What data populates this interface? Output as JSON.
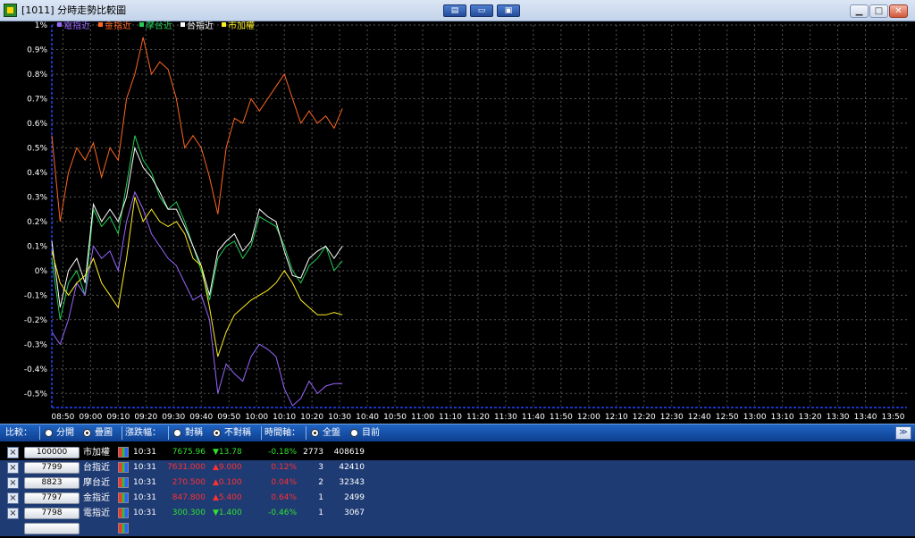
{
  "window": {
    "title": "[1011] 分時走勢比較圖",
    "toolbar_buttons": [
      "▤",
      "▭",
      "▣"
    ],
    "controls": {
      "minimize": "▁",
      "maximize": "□",
      "close": "✕"
    }
  },
  "legend": [
    {
      "name": "電指近",
      "color": "#9966ff"
    },
    {
      "name": "金指近",
      "color": "#ff6622"
    },
    {
      "name": "摩台近",
      "color": "#22cc55"
    },
    {
      "name": "台指近",
      "color": "#ffffff"
    },
    {
      "name": "市加權",
      "color": "#ffee22"
    }
  ],
  "chart_data": {
    "type": "line",
    "y_ticks": [
      "1%",
      "0.9%",
      "0.8%",
      "0.7%",
      "0.6%",
      "0.5%",
      "0.4%",
      "0.3%",
      "0.2%",
      "0.1%",
      "0%",
      "-0.1%",
      "-0.2%",
      "-0.3%",
      "-0.4%",
      "-0.5%"
    ],
    "x_ticks": [
      "08:50",
      "09:00",
      "09:10",
      "09:20",
      "09:30",
      "09:40",
      "09:50",
      "10:00",
      "10:10",
      "10:20",
      "10:30",
      "10:40",
      "10:50",
      "11:00",
      "11:10",
      "11:20",
      "11:30",
      "11:40",
      "11:50",
      "12:00",
      "12:10",
      "12:20",
      "12:30",
      "12:40",
      "12:50",
      "13:00",
      "13:10",
      "13:20",
      "13:30",
      "13:40",
      "13:50"
    ],
    "ylim": [
      -0.55,
      1.0
    ],
    "grid": true,
    "series": [
      {
        "name": "金指近",
        "color": "#ff6622",
        "x": [
          "08:46",
          "08:49",
          "08:52",
          "08:55",
          "08:58",
          "09:01",
          "09:04",
          "09:07",
          "09:10",
          "09:13",
          "09:16",
          "09:19",
          "09:22",
          "09:25",
          "09:28",
          "09:31",
          "09:34",
          "09:37",
          "09:40",
          "09:43",
          "09:46",
          "09:49",
          "09:52",
          "09:55",
          "09:58",
          "10:01",
          "10:04",
          "10:07",
          "10:10",
          "10:13",
          "10:16",
          "10:19",
          "10:22",
          "10:25",
          "10:28",
          "10:31"
        ],
        "values": [
          0.55,
          0.2,
          0.4,
          0.5,
          0.45,
          0.52,
          0.38,
          0.5,
          0.45,
          0.7,
          0.8,
          0.95,
          0.8,
          0.85,
          0.82,
          0.7,
          0.5,
          0.55,
          0.5,
          0.38,
          0.23,
          0.5,
          0.62,
          0.6,
          0.7,
          0.65,
          0.7,
          0.75,
          0.8,
          0.7,
          0.6,
          0.65,
          0.6,
          0.63,
          0.58,
          0.66
        ]
      },
      {
        "name": "摩台近",
        "color": "#22cc55",
        "x": [
          "08:46",
          "08:49",
          "08:52",
          "08:55",
          "08:58",
          "09:01",
          "09:04",
          "09:07",
          "09:10",
          "09:13",
          "09:16",
          "09:19",
          "09:22",
          "09:25",
          "09:28",
          "09:31",
          "09:34",
          "09:37",
          "09:40",
          "09:43",
          "09:46",
          "09:49",
          "09:52",
          "09:55",
          "09:58",
          "10:01",
          "10:04",
          "10:07",
          "10:10",
          "10:13",
          "10:16",
          "10:19",
          "10:22",
          "10:25",
          "10:28",
          "10:31"
        ],
        "values": [
          0.05,
          -0.2,
          -0.05,
          0.0,
          -0.1,
          0.25,
          0.18,
          0.22,
          0.15,
          0.35,
          0.55,
          0.45,
          0.4,
          0.3,
          0.25,
          0.28,
          0.2,
          0.1,
          0.0,
          -0.12,
          0.05,
          0.1,
          0.12,
          0.05,
          0.1,
          0.22,
          0.2,
          0.18,
          0.1,
          0.0,
          -0.05,
          0.02,
          0.05,
          0.1,
          0.0,
          0.04
        ]
      },
      {
        "name": "台指近",
        "color": "#ffffff",
        "x": [
          "08:46",
          "08:49",
          "08:52",
          "08:55",
          "08:58",
          "09:01",
          "09:04",
          "09:07",
          "09:10",
          "09:13",
          "09:16",
          "09:19",
          "09:22",
          "09:25",
          "09:28",
          "09:31",
          "09:34",
          "09:37",
          "09:40",
          "09:43",
          "09:46",
          "09:49",
          "09:52",
          "09:55",
          "09:58",
          "10:01",
          "10:04",
          "10:07",
          "10:10",
          "10:13",
          "10:16",
          "10:19",
          "10:22",
          "10:25",
          "10:28",
          "10:31"
        ],
        "values": [
          0.12,
          -0.15,
          0.0,
          0.05,
          -0.05,
          0.27,
          0.2,
          0.25,
          0.2,
          0.3,
          0.5,
          0.42,
          0.38,
          0.32,
          0.25,
          0.25,
          0.18,
          0.1,
          0.02,
          -0.1,
          0.08,
          0.12,
          0.15,
          0.08,
          0.12,
          0.25,
          0.22,
          0.2,
          0.08,
          -0.02,
          -0.03,
          0.05,
          0.08,
          0.1,
          0.05,
          0.1
        ]
      },
      {
        "name": "電指近",
        "color": "#9966ff",
        "x": [
          "08:46",
          "08:49",
          "08:52",
          "08:55",
          "08:58",
          "09:01",
          "09:04",
          "09:07",
          "09:10",
          "09:13",
          "09:16",
          "09:19",
          "09:22",
          "09:25",
          "09:28",
          "09:31",
          "09:34",
          "09:37",
          "09:40",
          "09:43",
          "09:46",
          "09:49",
          "09:52",
          "09:55",
          "09:58",
          "10:01",
          "10:04",
          "10:07",
          "10:10",
          "10:13",
          "10:16",
          "10:19",
          "10:22",
          "10:25",
          "10:28",
          "10:31"
        ],
        "values": [
          -0.25,
          -0.3,
          -0.2,
          -0.05,
          -0.1,
          0.1,
          0.05,
          0.08,
          0.0,
          0.2,
          0.32,
          0.25,
          0.15,
          0.1,
          0.05,
          0.02,
          -0.05,
          -0.12,
          -0.1,
          -0.2,
          -0.5,
          -0.38,
          -0.42,
          -0.45,
          -0.35,
          -0.3,
          -0.32,
          -0.35,
          -0.48,
          -0.55,
          -0.52,
          -0.45,
          -0.5,
          -0.47,
          -0.46,
          -0.46
        ]
      },
      {
        "name": "市加權",
        "color": "#ffee22",
        "x": [
          "08:46",
          "08:49",
          "08:52",
          "08:55",
          "08:58",
          "09:01",
          "09:04",
          "09:07",
          "09:10",
          "09:13",
          "09:16",
          "09:19",
          "09:22",
          "09:25",
          "09:28",
          "09:31",
          "09:34",
          "09:37",
          "09:40",
          "09:43",
          "09:46",
          "09:49",
          "09:52",
          "09:55",
          "09:58",
          "10:01",
          "10:04",
          "10:07",
          "10:10",
          "10:13",
          "10:16",
          "10:19",
          "10:22",
          "10:25",
          "10:28",
          "10:31"
        ],
        "values": [
          0.08,
          -0.05,
          -0.1,
          -0.05,
          -0.02,
          0.05,
          -0.05,
          -0.1,
          -0.15,
          0.05,
          0.3,
          0.2,
          0.25,
          0.2,
          0.18,
          0.2,
          0.15,
          0.05,
          0.02,
          -0.15,
          -0.35,
          -0.25,
          -0.18,
          -0.15,
          -0.12,
          -0.1,
          -0.08,
          -0.05,
          0.0,
          -0.05,
          -0.12,
          -0.15,
          -0.18,
          -0.18,
          -0.17,
          -0.18
        ]
      }
    ]
  },
  "compare_bar": {
    "compare_label": "比較：",
    "separate": "分開",
    "overlay": "疊圖",
    "range_label": "漲跌幅：",
    "symmetric": "對稱",
    "asymmetric": "不對稱",
    "time_axis_label": "時間軸：",
    "full_day": "全盤",
    "current": "目前",
    "expand": "≫"
  },
  "rows": [
    {
      "code": "100000",
      "name": "市加權",
      "time": "10:31",
      "price": "7675.96",
      "change": "▼13.78",
      "pct": "-0.18%",
      "vol": "2773",
      "total": "408619",
      "up": false
    },
    {
      "code": "7799",
      "name": "台指近",
      "time": "10:31",
      "price": "7631.000",
      "change": "▲9.000",
      "pct": "0.12%",
      "vol": "3",
      "total": "42410",
      "up": true
    },
    {
      "code": "8823",
      "name": "摩台近",
      "time": "10:31",
      "price": "270.500",
      "change": "▲0.100",
      "pct": "0.04%",
      "vol": "2",
      "total": "32343",
      "up": true
    },
    {
      "code": "7797",
      "name": "金指近",
      "time": "10:31",
      "price": "847.800",
      "change": "▲5.400",
      "pct": "0.64%",
      "vol": "1",
      "total": "2499",
      "up": true
    },
    {
      "code": "7798",
      "name": "電指近",
      "time": "10:31",
      "price": "300.300",
      "change": "▼1.400",
      "pct": "-0.46%",
      "vol": "1",
      "total": "3067",
      "up": false
    }
  ],
  "colors": {
    "up": "#ff3030",
    "down": "#30e030",
    "grid": "#555555",
    "axis": "#2244ff"
  }
}
